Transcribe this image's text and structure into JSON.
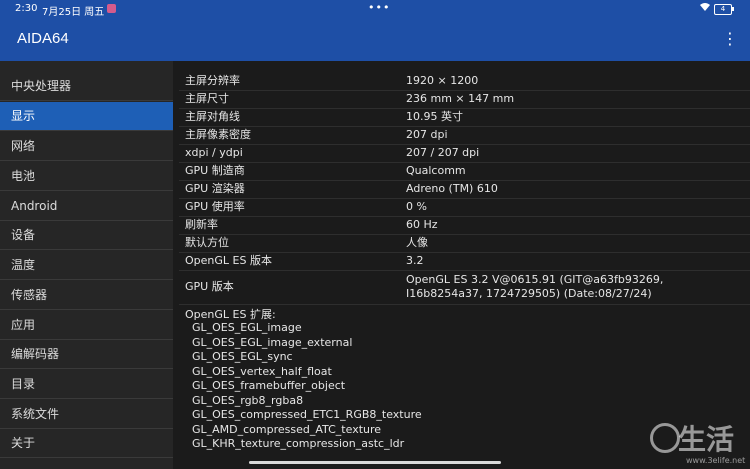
{
  "statusbar": {
    "time": "2:30",
    "date": "7月25日 周五",
    "dots": "•••",
    "battery": "4"
  },
  "appbar": {
    "title": "AIDA64",
    "menu_icon": "⋮"
  },
  "sidebar": {
    "items": [
      {
        "label": "中央处理器"
      },
      {
        "label": "显示"
      },
      {
        "label": "网络"
      },
      {
        "label": "电池"
      },
      {
        "label": "Android"
      },
      {
        "label": "设备"
      },
      {
        "label": "温度"
      },
      {
        "label": "传感器"
      },
      {
        "label": "应用"
      },
      {
        "label": "编解码器"
      },
      {
        "label": "目录"
      },
      {
        "label": "系统文件"
      },
      {
        "label": "关于"
      }
    ]
  },
  "display_info": {
    "rows": [
      {
        "key": "主屏分辨率",
        "value": "1920 × 1200"
      },
      {
        "key": "主屏尺寸",
        "value": "236 mm × 147 mm"
      },
      {
        "key": "主屏对角线",
        "value": "10.95 英寸"
      },
      {
        "key": "主屏像素密度",
        "value": "207 dpi"
      },
      {
        "key": "xdpi / ydpi",
        "value": "207 / 207 dpi"
      },
      {
        "key": "GPU 制造商",
        "value": "Qualcomm"
      },
      {
        "key": "GPU 渲染器",
        "value": "Adreno (TM) 610"
      },
      {
        "key": "GPU 使用率",
        "value": "0 %"
      },
      {
        "key": "刷新率",
        "value": "60 Hz"
      },
      {
        "key": "默认方位",
        "value": "人像"
      },
      {
        "key": "OpenGL ES 版本",
        "value": "3.2"
      },
      {
        "key": "GPU 版本",
        "value": "OpenGL ES 3.2 V@0615.91 (GIT@a63fb93269, I16b8254a37, 1724729505) (Date:08/27/24)"
      }
    ],
    "extensions_title": "OpenGL ES 扩展:",
    "extensions": [
      "GL_OES_EGL_image",
      "GL_OES_EGL_image_external",
      "GL_OES_EGL_sync",
      "GL_OES_vertex_half_float",
      "GL_OES_framebuffer_object",
      "GL_OES_rgb8_rgba8",
      "GL_OES_compressed_ETC1_RGB8_texture",
      "GL_AMD_compressed_ATC_texture",
      "GL_KHR_texture_compression_astc_ldr"
    ]
  },
  "watermark": {
    "text": "生活",
    "url": "www.3elife.net"
  }
}
